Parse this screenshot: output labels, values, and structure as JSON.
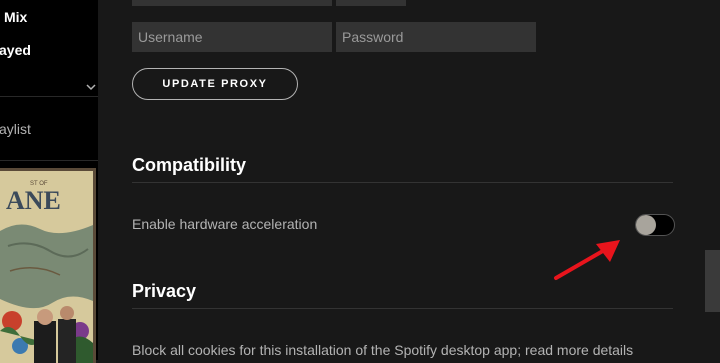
{
  "sidebar": {
    "items": [
      {
        "label": "Mix"
      },
      {
        "label": "ayed"
      },
      {
        "label": "aylist"
      }
    ]
  },
  "proxy": {
    "username_placeholder": "Username",
    "password_placeholder": "Password",
    "update_label": "UPDATE PROXY"
  },
  "compatibility": {
    "title": "Compatibility",
    "hardware_accel_label": "Enable hardware acceleration",
    "hardware_accel_enabled": false
  },
  "privacy": {
    "title": "Privacy",
    "cookies_label": "Block all cookies for this installation of the Spotify desktop app; read more details"
  },
  "colors": {
    "background": "#181818",
    "sidebar": "#000000",
    "annotation_arrow": "#e8141c"
  }
}
